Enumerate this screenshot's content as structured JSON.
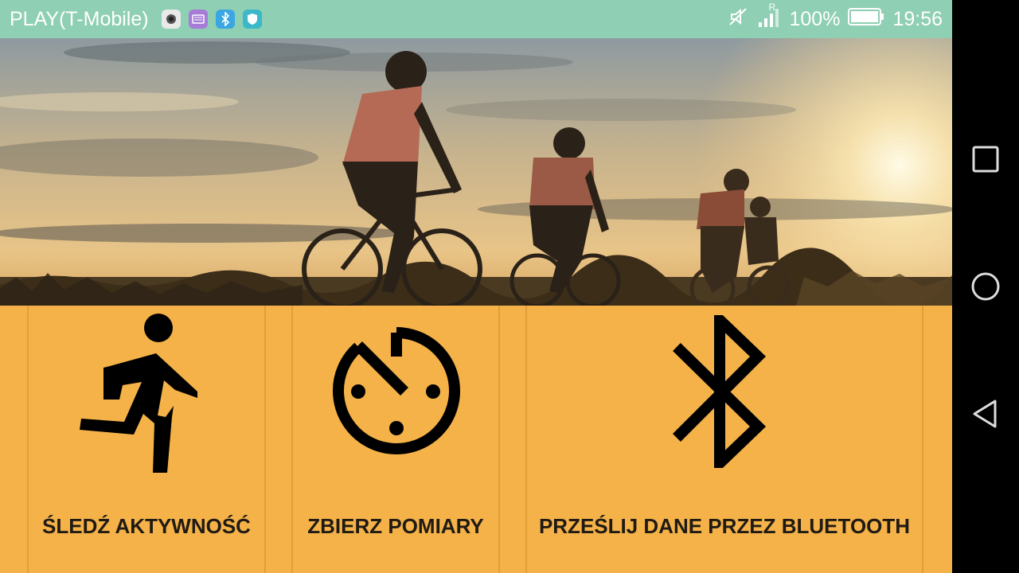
{
  "status_bar": {
    "carrier": "PLAY(T-Mobile)",
    "roaming_indicator": "R",
    "battery": "100%",
    "time": "19:56",
    "icons": [
      "camera-icon",
      "keyboard-icon",
      "bluetooth-icon",
      "shield-icon",
      "mute-icon",
      "signal-icon",
      "battery-icon"
    ]
  },
  "hero": {
    "image": "cyclists-at-sunset"
  },
  "tiles": [
    {
      "label": "ŚLEDŹ AKTYWNOŚĆ",
      "icon": "running-person-icon"
    },
    {
      "label": "ZBIERZ POMIARY",
      "icon": "timer-icon"
    },
    {
      "label": "PRZEŚLIJ DANE PRZEZ BLUETOOTH",
      "icon": "bluetooth-icon"
    }
  ],
  "colors": {
    "status_bar": "#8fcfb3",
    "tile_bg": "#f4b248",
    "icon": "#000000",
    "label": "#1f1a14"
  },
  "nav_bar": {
    "buttons": [
      "recents-button",
      "home-button",
      "back-button"
    ]
  }
}
